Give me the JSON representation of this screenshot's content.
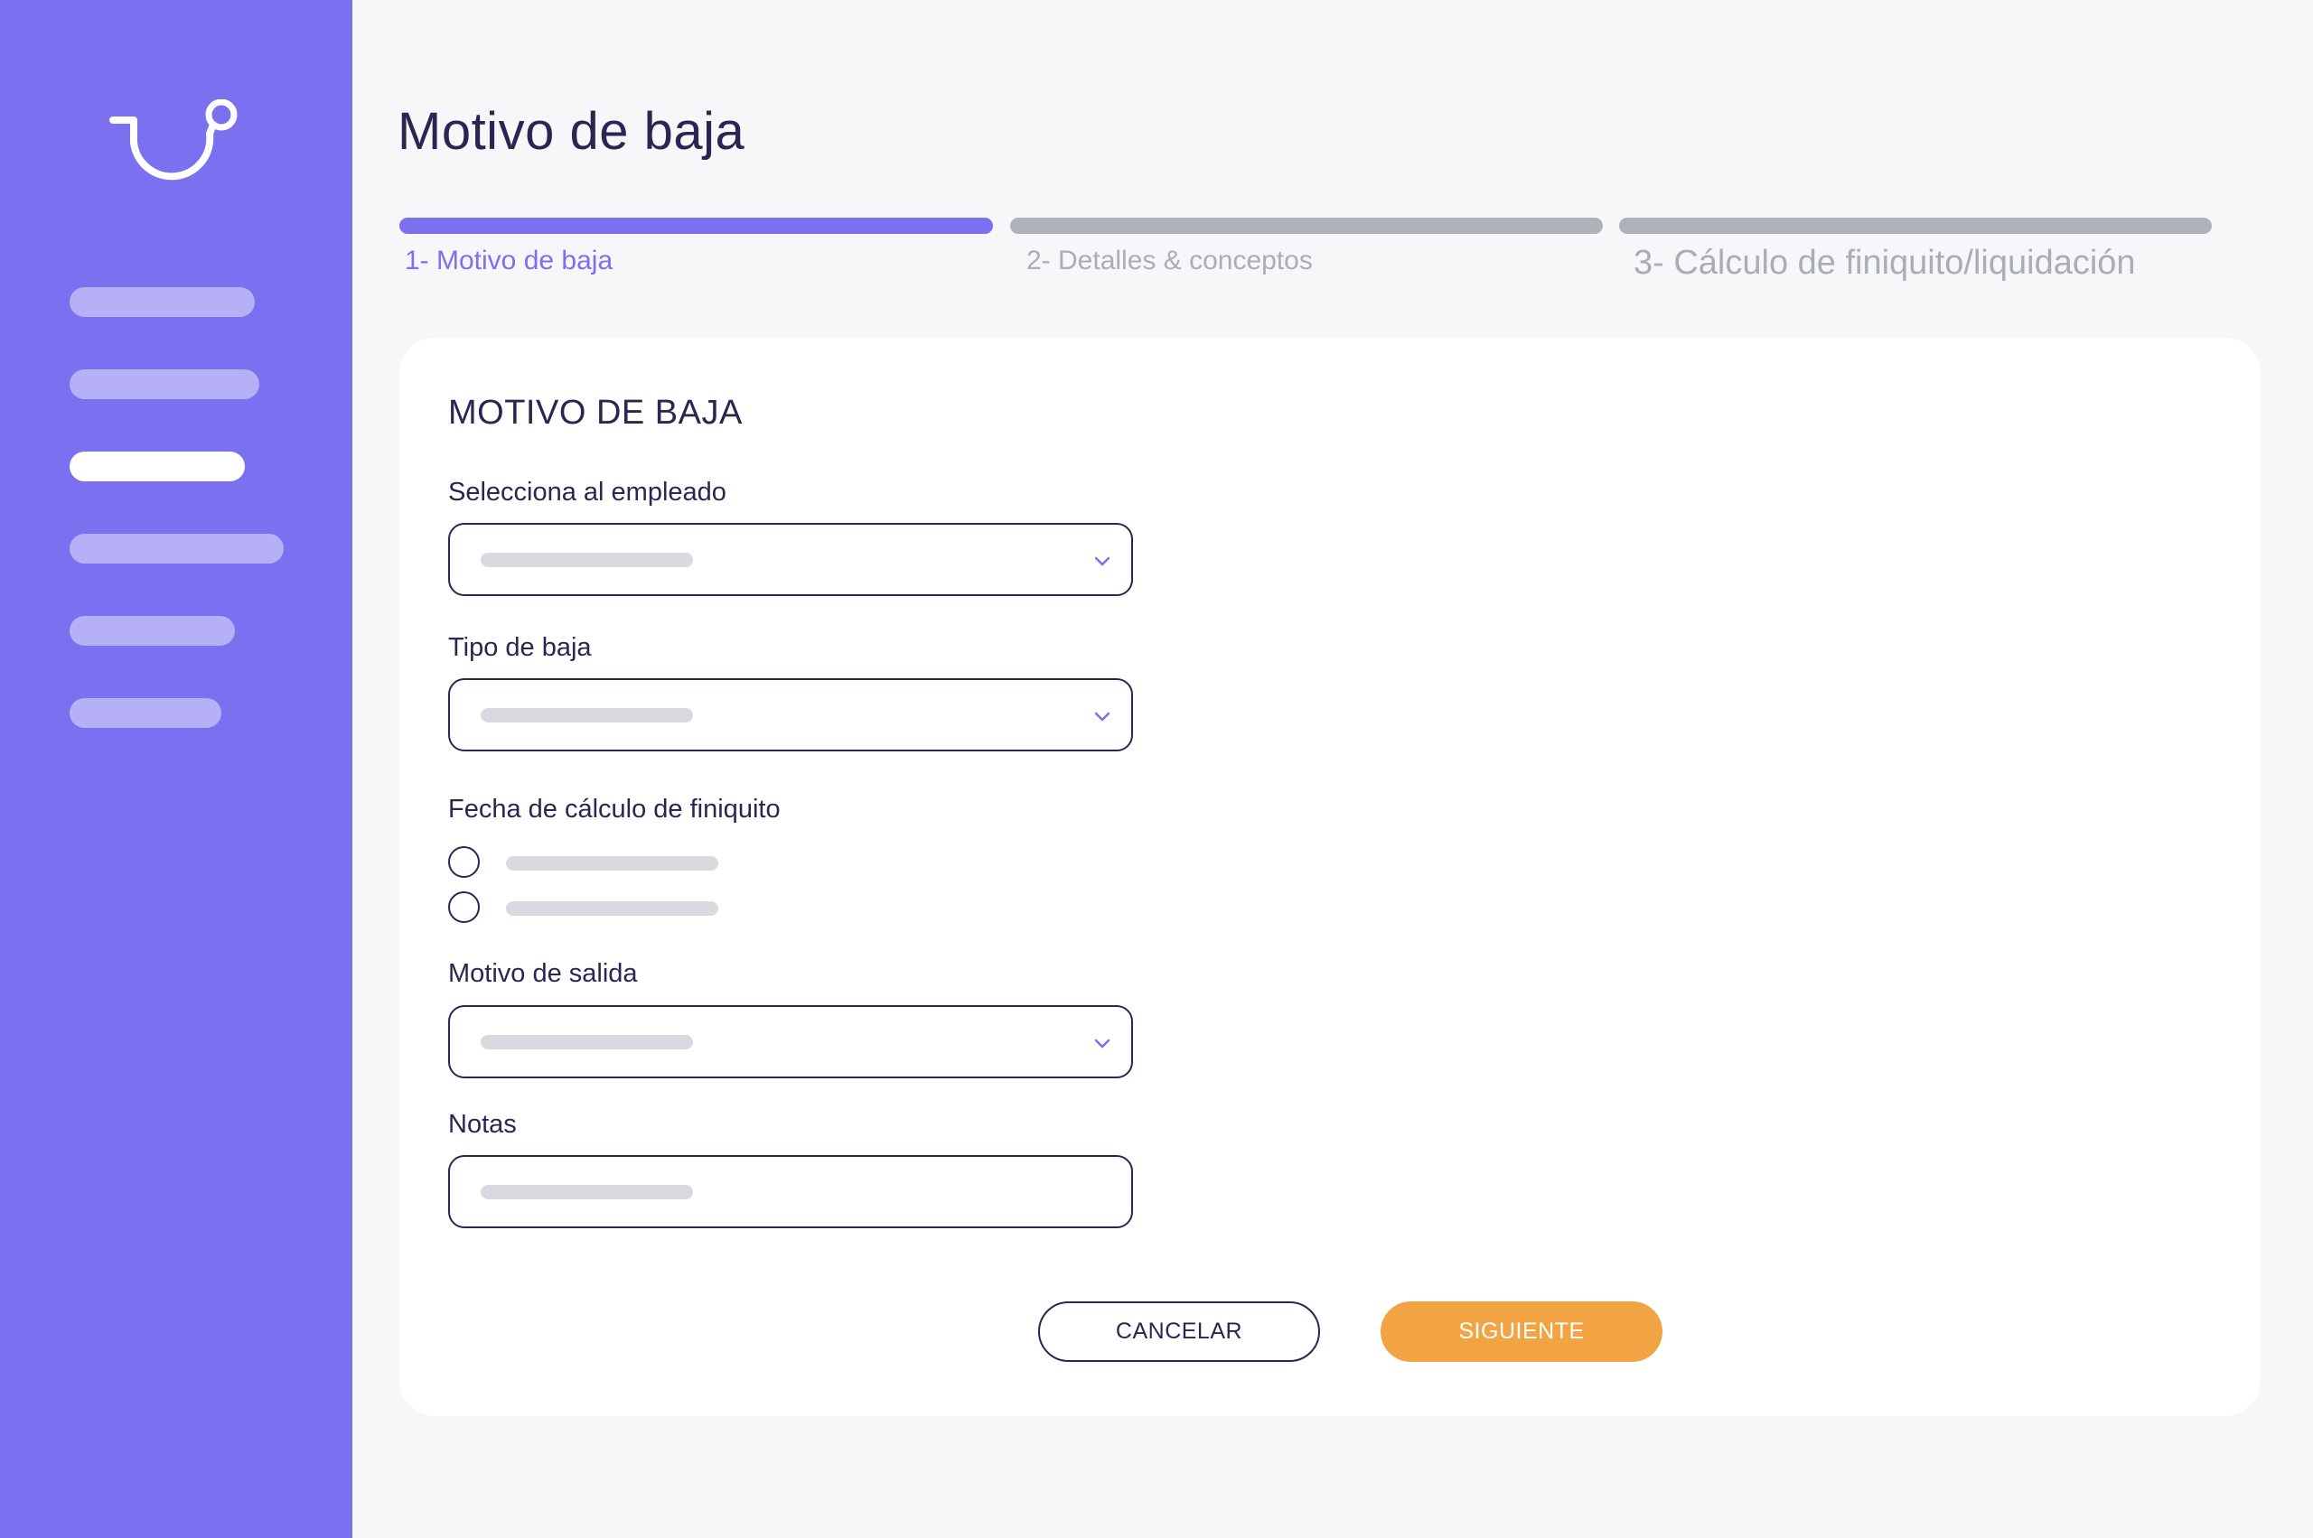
{
  "sidebar": {
    "logo_icon": "brand-smile-logo-icon",
    "nav_items": [
      {
        "name": "nav-item-1",
        "active": false
      },
      {
        "name": "nav-item-2",
        "active": false
      },
      {
        "name": "nav-item-3",
        "active": true
      },
      {
        "name": "nav-item-4",
        "active": false
      },
      {
        "name": "nav-item-5",
        "active": false
      },
      {
        "name": "nav-item-6",
        "active": false
      }
    ]
  },
  "page": {
    "title": "Motivo de baja"
  },
  "steps": [
    {
      "label": "1- Motivo de baja",
      "active": true
    },
    {
      "label": "2- Detalles & conceptos",
      "active": false
    },
    {
      "label": "3- Cálculo de finiquito/liquidación",
      "active": false
    }
  ],
  "form": {
    "title": "MOTIVO DE BAJA",
    "employee_label": "Selecciona al empleado",
    "type_label": "Tipo de baja",
    "date_label": "Fecha de cálculo de finiquito",
    "reason_label": "Motivo de salida",
    "notes_label": "Notas",
    "chevron_icon": "chevron-down-icon"
  },
  "buttons": {
    "cancel": "CANCELAR",
    "next": "SIGUIENTE"
  },
  "colors": {
    "primary": "#7b70f0",
    "dark_text": "#2c2552",
    "accent": "#f2a443",
    "inactive": "#aeb3bb"
  }
}
